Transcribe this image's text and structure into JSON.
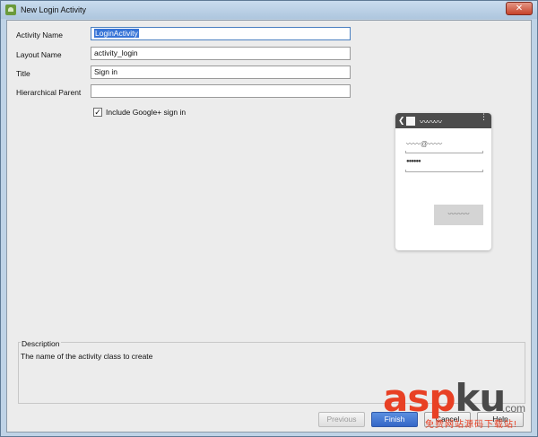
{
  "window": {
    "title": "New Login Activity",
    "close_label": "✕"
  },
  "form": {
    "activity_name": {
      "label": "Activity Name",
      "value": "LoginActivity"
    },
    "layout_name": {
      "label": "Layout Name",
      "value": "activity_login"
    },
    "title": {
      "label": "Title",
      "value": "Sign in"
    },
    "hierarchical_parent": {
      "label": "Hierarchical Parent",
      "value": ""
    },
    "google_signin": {
      "label": "Include Google+ sign in",
      "checked": true,
      "checkmark": "✓"
    }
  },
  "preview": {
    "back_glyph": "❮",
    "title_squiggle": "〰〰〰",
    "menu_glyph": "⋮",
    "email_placeholder": "〰〰@〰〰",
    "password_placeholder": "●●●●●●",
    "button_squiggle": "〰〰〰"
  },
  "description": {
    "legend": "Description",
    "text": "The name of the activity class to create"
  },
  "buttons": {
    "previous": "Previous",
    "finish": "Finish",
    "cancel": "Cancel",
    "help": "Help"
  },
  "watermark": {
    "main_prefix": "asp",
    "main_suffix": "ku",
    "dot_com": ".com",
    "subtitle": "免费网站源码下载站!"
  },
  "colors": {
    "accent": "#3467c7",
    "selection": "#3875d7",
    "watermark_red": "#e84024"
  }
}
